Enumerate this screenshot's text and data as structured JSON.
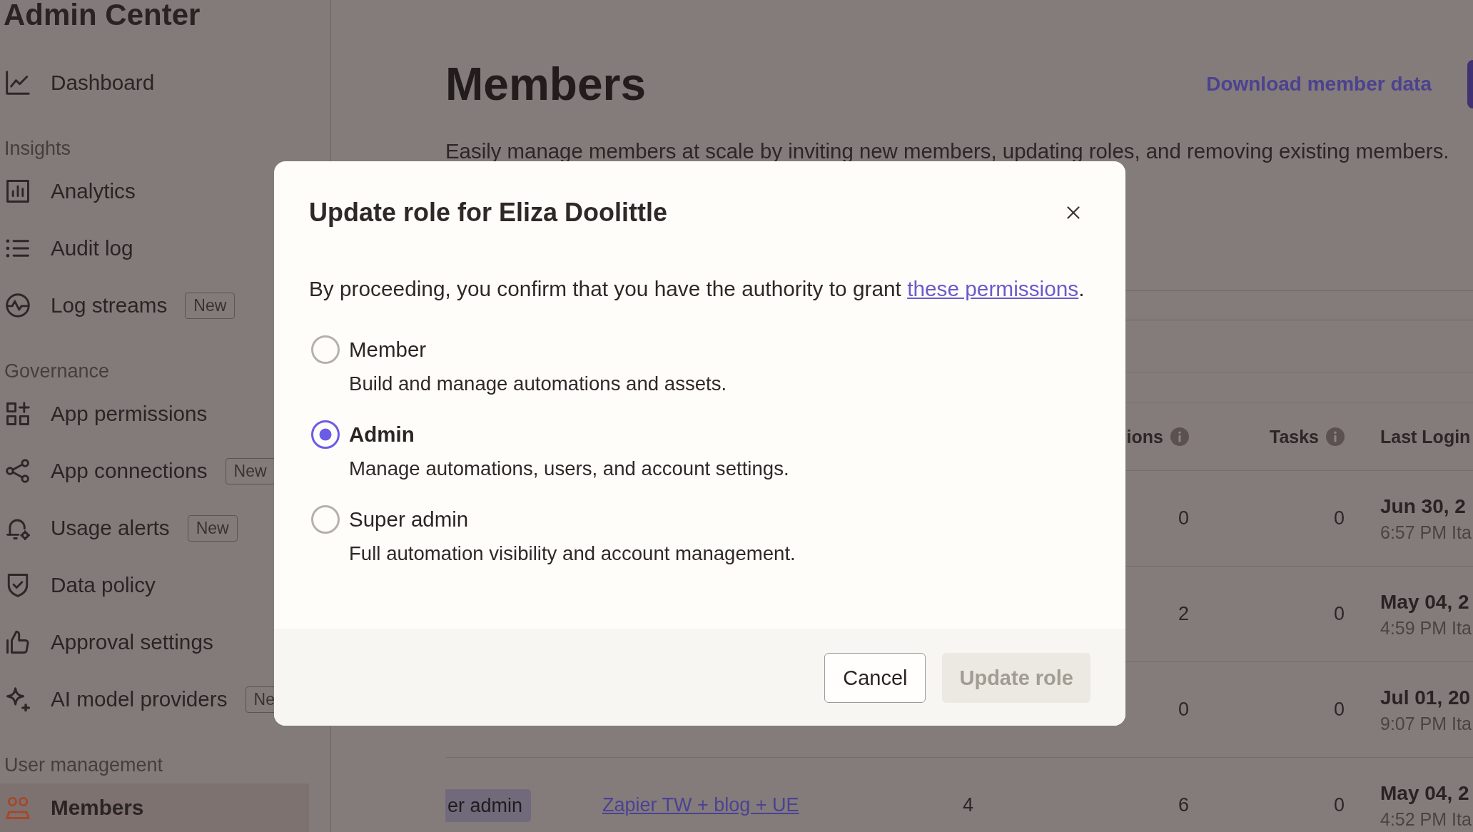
{
  "sidebar": {
    "title": "Admin Center",
    "groups": [
      {
        "items": [
          {
            "label": "Dashboard",
            "selected": false
          }
        ]
      },
      {
        "heading": "Insights",
        "items": [
          {
            "label": "Analytics",
            "selected": false
          },
          {
            "label": "Audit log",
            "selected": false
          },
          {
            "label": "Log streams",
            "badge": "New",
            "selected": false
          }
        ]
      },
      {
        "heading": "Governance",
        "items": [
          {
            "label": "App permissions",
            "selected": false
          },
          {
            "label": "App connections",
            "badge": "New",
            "selected": false
          },
          {
            "label": "Usage alerts",
            "badge": "New",
            "selected": false
          },
          {
            "label": "Data policy",
            "selected": false
          },
          {
            "label": "Approval settings",
            "selected": false
          },
          {
            "label": "AI model providers",
            "badge": "Ne",
            "selected": false
          }
        ]
      },
      {
        "heading": "User management",
        "items": [
          {
            "label": "Members",
            "selected": true
          }
        ]
      }
    ]
  },
  "page": {
    "title": "Members",
    "download_link": "Download member data",
    "description": "Easily manage members at scale by inviting new members, updating roles, and removing existing members."
  },
  "table": {
    "columns": [
      {
        "label": "ions",
        "info": true
      },
      {
        "label": "Tasks",
        "info": true
      },
      {
        "label": "Last Login",
        "info": false
      }
    ],
    "rows": [
      {
        "column_4": "0",
        "tasks": "0",
        "last_login": {
          "date": "Jun 30, 2",
          "time": "6:57 PM Ita"
        }
      },
      {
        "column_4": "2",
        "tasks": "0",
        "last_login": {
          "date": "May 04, 2",
          "time": "4:59 PM Ita"
        }
      },
      {
        "column_4": "0",
        "tasks": "0",
        "last_login": {
          "date": "Jul 01, 20",
          "time": "9:07 PM Ita"
        }
      },
      {
        "column_1": "er admin",
        "column_2": "Zapier TW + blog + UE",
        "column_3": "4",
        "column_4": "6",
        "tasks": "0",
        "last_login": {
          "date": "May 04, 2",
          "time": "4:52 PM Ita"
        }
      }
    ]
  },
  "dialog": {
    "title": "Update role for Eliza Doolittle",
    "intro": {
      "before": "By proceeding, you confirm that you have the authority to grant",
      "link": "these permissions",
      "after": "."
    },
    "options": [
      {
        "label": "Member",
        "description": "Build and manage automations and assets.",
        "selected": false
      },
      {
        "label": "Admin",
        "description": "Manage automations, users, and account settings.",
        "selected": true
      },
      {
        "label": "Super admin",
        "description": "Full automation visibility and account management.",
        "selected": false
      }
    ],
    "buttons": [
      {
        "label": "Cancel",
        "kind": "secondary",
        "disabled": false
      },
      {
        "label": "Update role",
        "kind": "primary",
        "disabled": true
      }
    ]
  }
}
